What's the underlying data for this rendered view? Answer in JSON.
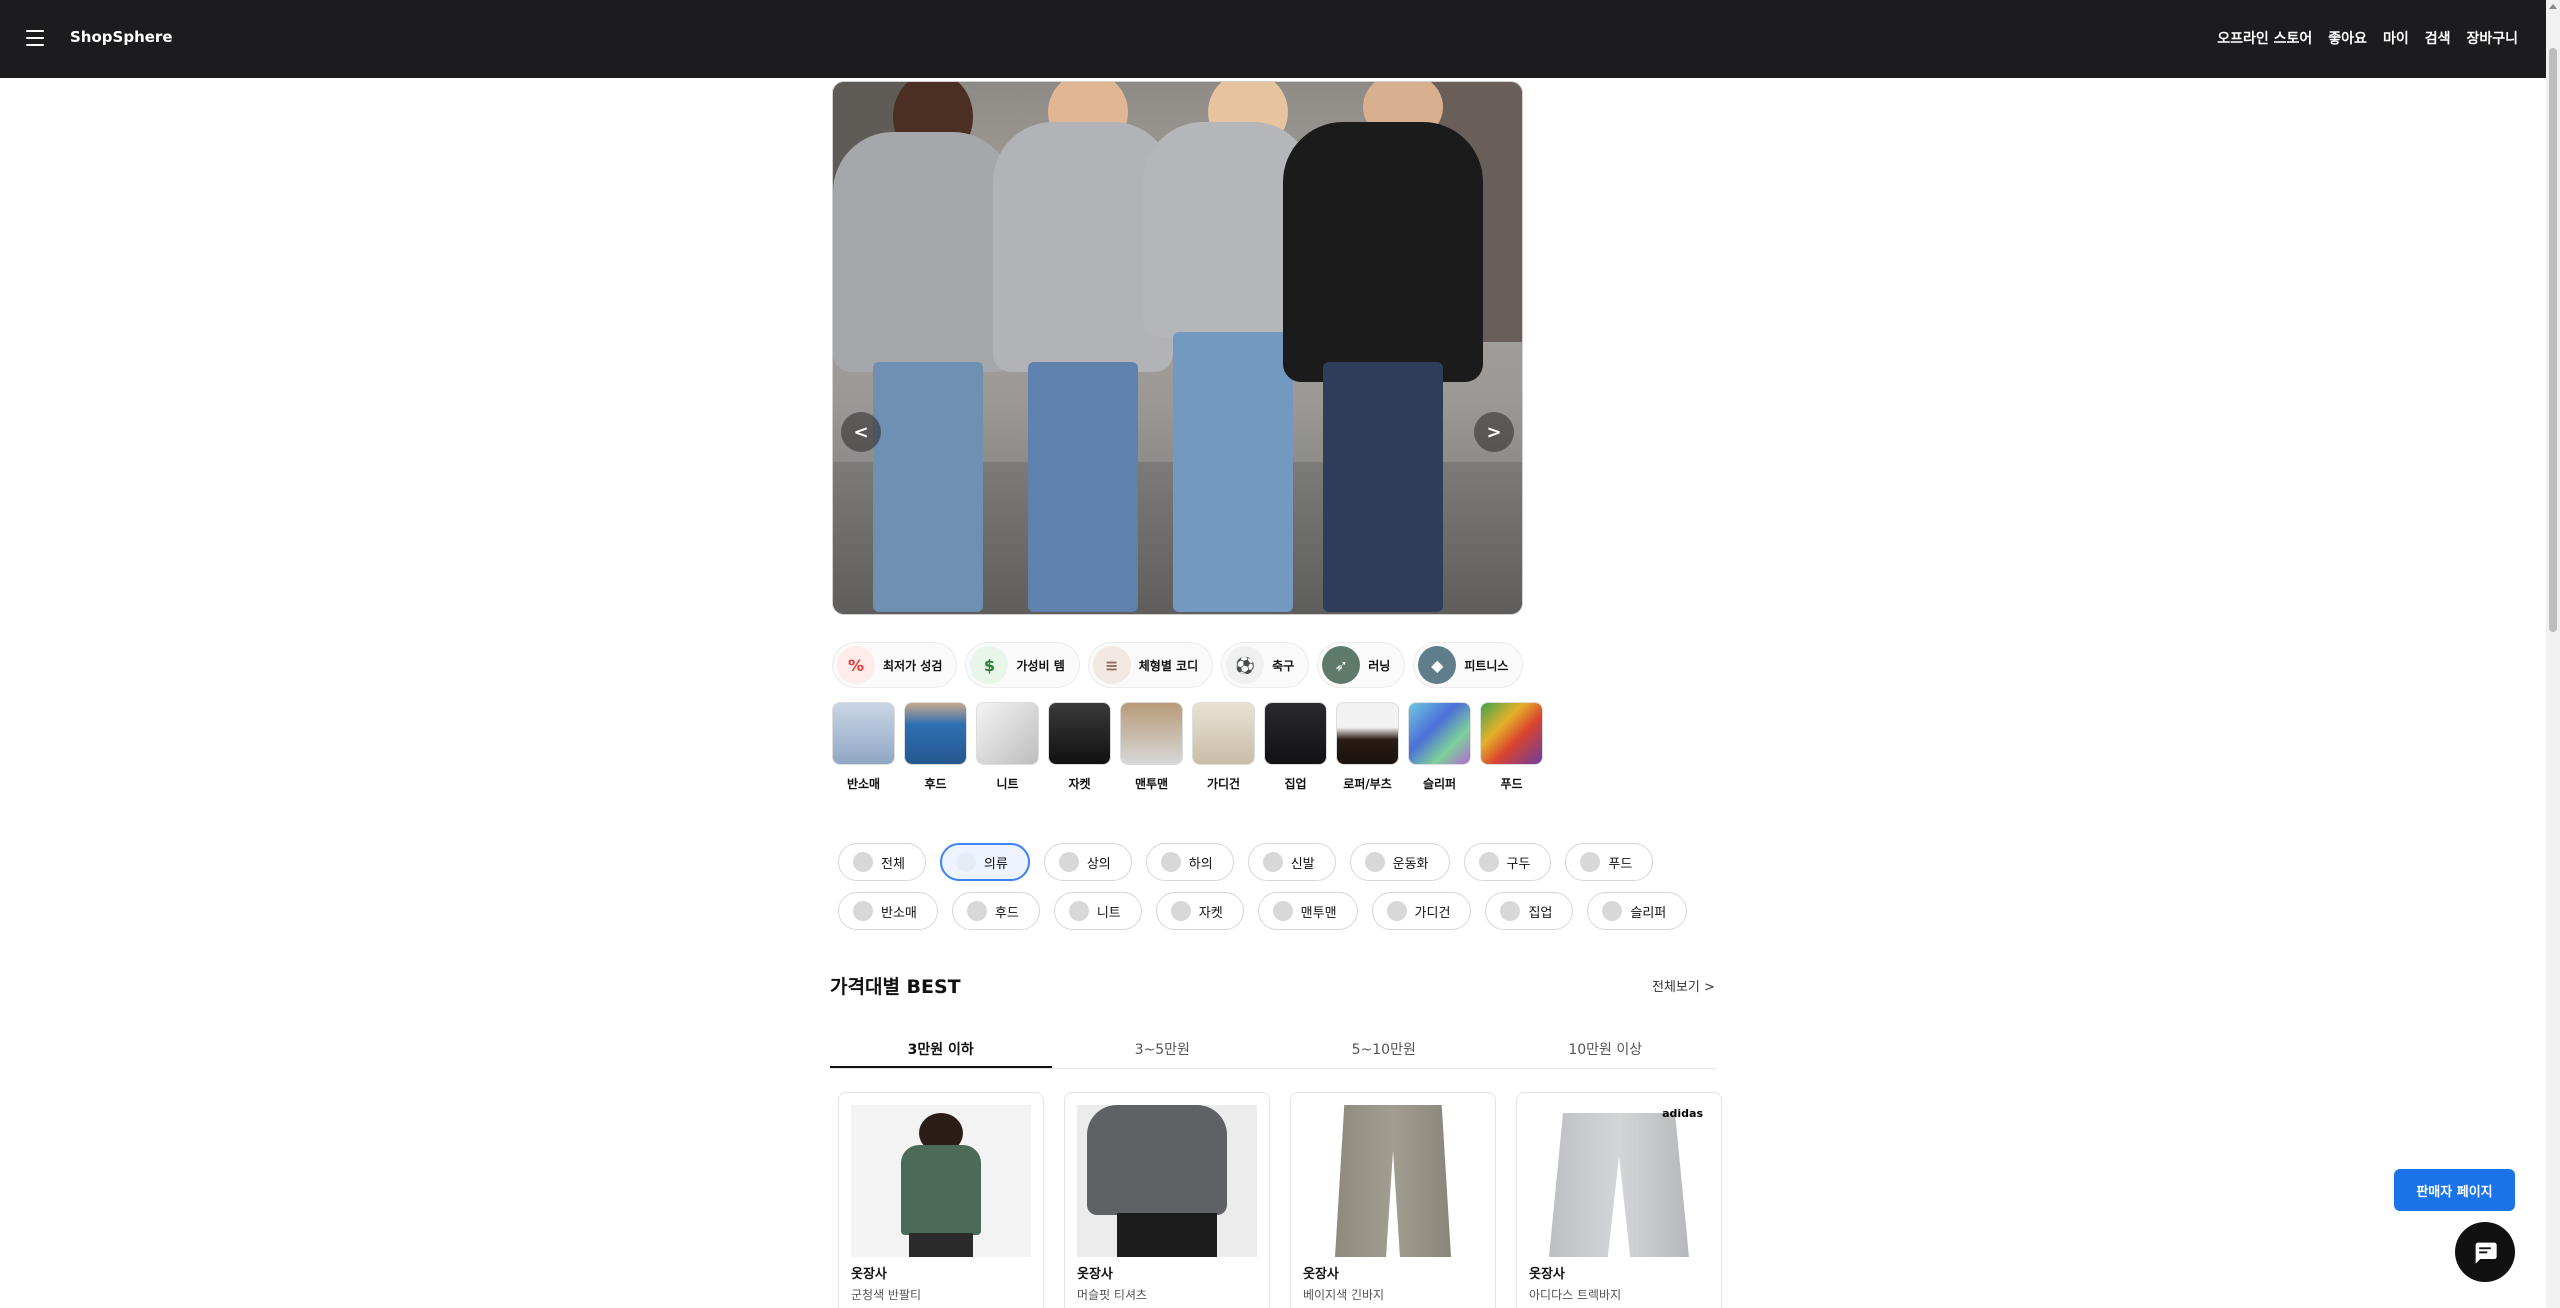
{
  "header": {
    "brand": "ShopSphere",
    "nav": [
      "오프라인 스토어",
      "좋아요",
      "마이",
      "검색",
      "장바구니"
    ]
  },
  "hero": {
    "prev_label": "<",
    "next_label": ">"
  },
  "themes": [
    {
      "label": "최저가 성검",
      "icon": "sale-icon",
      "color": "#e53935"
    },
    {
      "label": "가성비 템",
      "icon": "money-icon",
      "color": "#2e7d32"
    },
    {
      "label": "체형별 코디",
      "icon": "burger-icon",
      "color": "#8d6e63"
    },
    {
      "label": "축구",
      "icon": "soccer-ball-icon",
      "color": "#222222"
    },
    {
      "label": "러닝",
      "icon": "running-icon",
      "color": "#5d7a6b"
    },
    {
      "label": "피트니스",
      "icon": "fitness-icon",
      "color": "#607d8b"
    }
  ],
  "categories": [
    "반소매",
    "후드",
    "니트",
    "자켓",
    "맨투맨",
    "가디건",
    "집업",
    "로퍼/부츠",
    "슬리퍼",
    "푸드"
  ],
  "filters": {
    "row1": [
      "전체",
      "의류",
      "상의",
      "하의",
      "신발",
      "운동화",
      "구두",
      "푸드"
    ],
    "row2": [
      "반소매",
      "후드",
      "니트",
      "자켓",
      "맨투맨",
      "가디건",
      "집업",
      "슬리퍼"
    ],
    "active": "의류"
  },
  "best": {
    "title": "가격대별 BEST",
    "view_all": "전체보기 >",
    "tabs": [
      "3만원 이하",
      "3~5만원",
      "5~10만원",
      "10만원 이상"
    ],
    "active_tab": "3만원 이하",
    "products": [
      {
        "brand": "옷장사",
        "name": "군청색 반팔티"
      },
      {
        "brand": "옷장사",
        "name": "머슬핏 티셔츠"
      },
      {
        "brand": "옷장사",
        "name": "베이지색 긴바지"
      },
      {
        "brand": "옷장사",
        "name": "아디다스 트렉바지",
        "logo": "adidas"
      }
    ]
  },
  "floating": {
    "seller_button": "판매자 페이지",
    "chat_icon": "chat-icon"
  },
  "colors": {
    "header_bg": "#1c1c1f",
    "accent": "#1a73e8",
    "active_pill": "#3b82f6"
  }
}
